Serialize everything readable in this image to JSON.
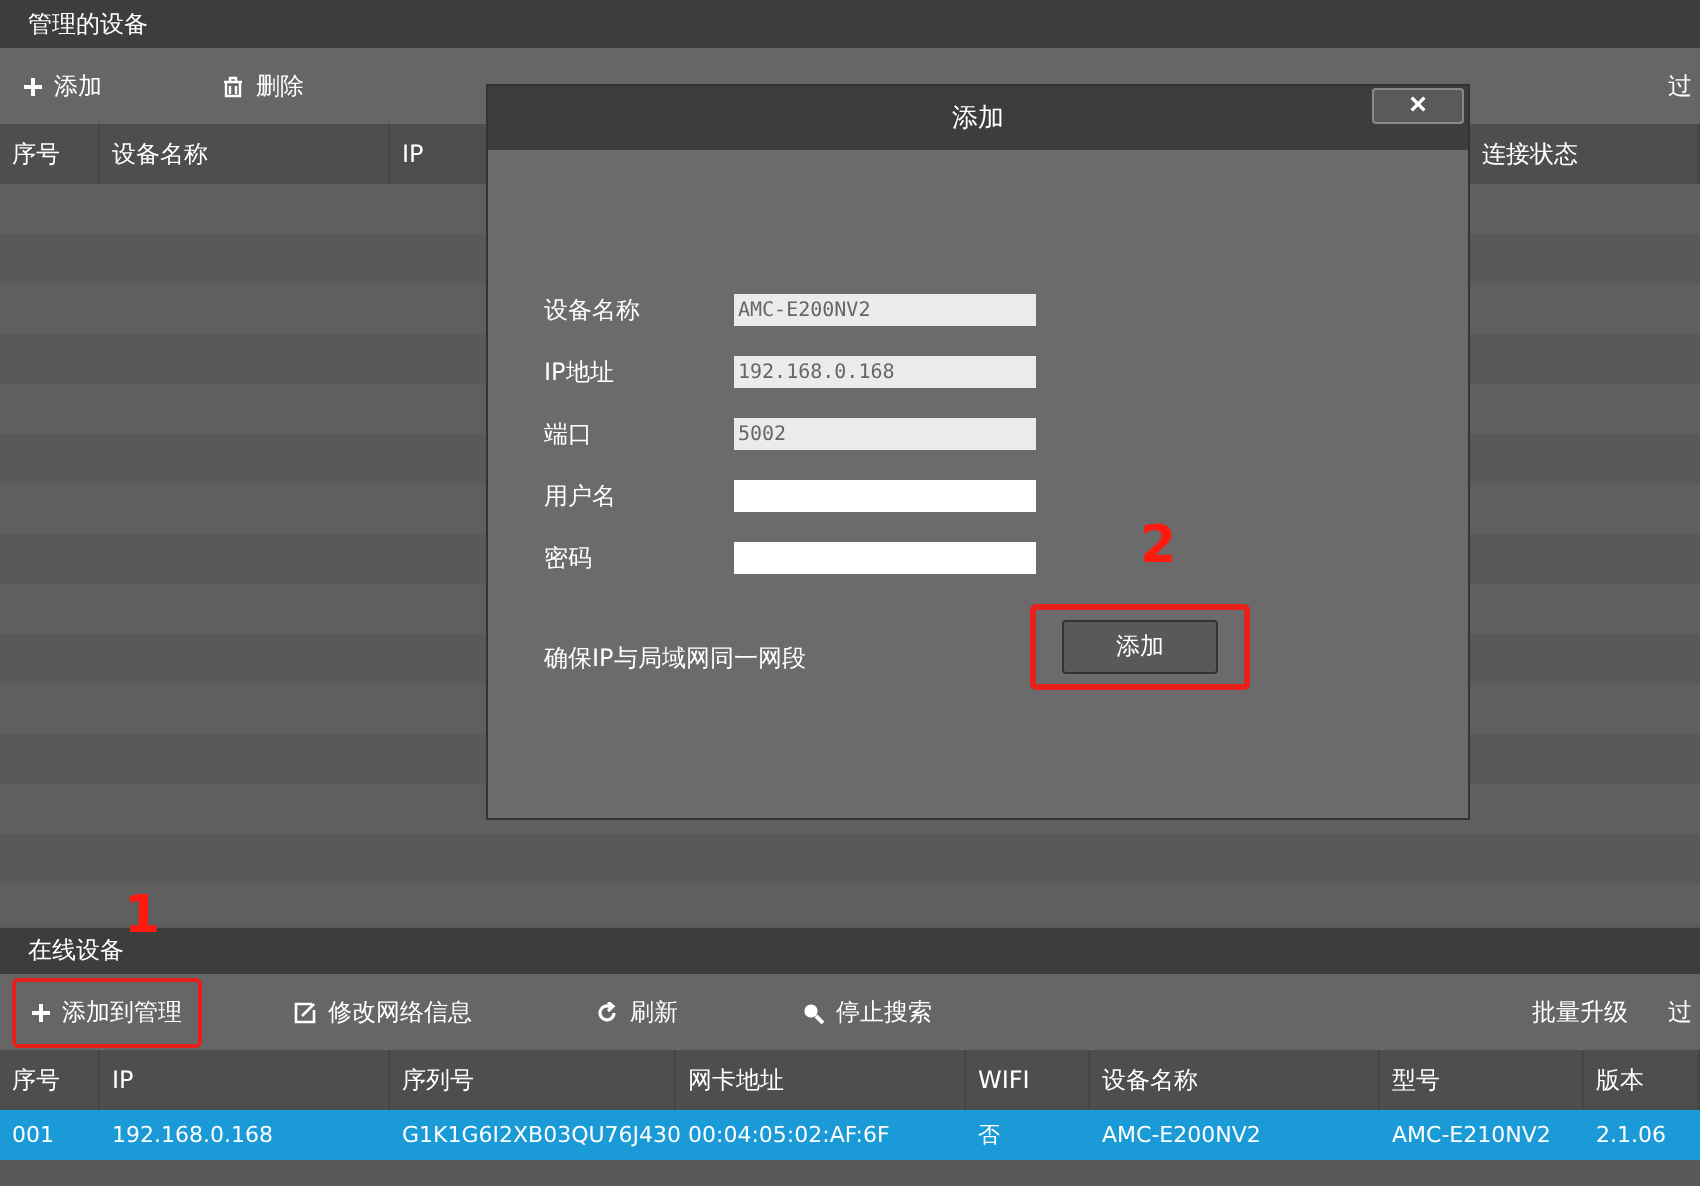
{
  "managed_devices": {
    "title": "管理的设备",
    "toolbar": [
      {
        "kind": "plus",
        "label": "添加"
      },
      {
        "kind": "trash",
        "label": "删除"
      },
      {
        "kind": "text",
        "label": "过"
      }
    ],
    "table": {
      "columns": [
        "序号",
        "设备名称",
        "IP",
        "连接状态"
      ]
    }
  },
  "dialog": {
    "title": "添加",
    "close": "×",
    "fields": [
      {
        "label": "设备名称",
        "value": "AMC-E200NV2",
        "disabled": true
      },
      {
        "label": "IP地址",
        "value": "192.168.0.168",
        "disabled": true
      },
      {
        "label": "端口",
        "value": "5002",
        "disabled": true
      },
      {
        "label": "用户名",
        "disabled": false
      },
      {
        "label": "密码",
        "disabled": false
      }
    ],
    "note": "确保IP与局域网同一网段",
    "button": "添加",
    "annotation": "2"
  },
  "online_devices": {
    "title": "在线设备",
    "annotation": "1",
    "toolbar": [
      {
        "kind": "plus",
        "label": "添加到管理",
        "highlighted": true
      },
      {
        "kind": "edit",
        "label": "修改网络信息",
        "highlighted": false
      },
      {
        "kind": "refresh",
        "label": "刷新",
        "highlighted": false
      },
      {
        "kind": "search",
        "label": "停止搜索",
        "highlighted": false
      }
    ],
    "toolbar_right": [
      {
        "label": "批量升级"
      },
      {
        "label": "过"
      }
    ],
    "table": {
      "columns": [
        "序号",
        "IP",
        "序列号",
        "网卡地址",
        "WIFI",
        "设备名称",
        "型号",
        "版本"
      ],
      "rows": [
        {
          "selected": true,
          "cells": [
            "001",
            "192.168.0.168",
            "G1K1G6I2XB03QU76J430",
            "00:04:05:02:AF:6F",
            "否",
            "AMC-E200NV2",
            "AMC-E210NV2",
            "2.1.06"
          ]
        }
      ]
    }
  }
}
